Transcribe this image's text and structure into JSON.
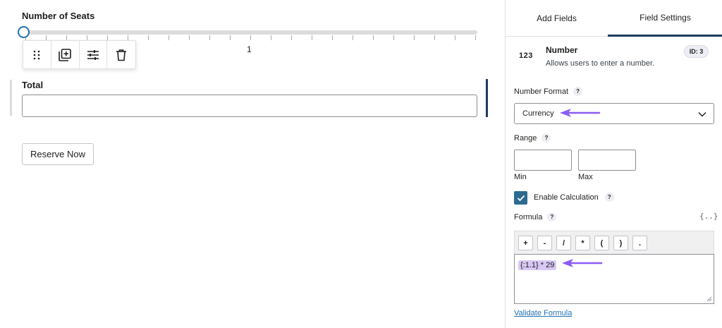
{
  "canvas": {
    "seats_label": "Number of Seats",
    "slider_value": "1",
    "slider_level": 0,
    "total_label": "Total",
    "total_value": "",
    "reserve_button": "Reserve Now"
  },
  "toolbar": {
    "icons": [
      "drag-handle-icon",
      "duplicate-icon",
      "settings-sliders-icon",
      "trash-icon"
    ]
  },
  "sidebar": {
    "tabs": [
      {
        "label": "Add Fields",
        "active": false
      },
      {
        "label": "Field Settings",
        "active": true
      }
    ],
    "field": {
      "icon_text": "123",
      "name": "Number",
      "description": "Allows users to enter a number.",
      "id_badge": "ID: 3"
    },
    "number_format": {
      "label": "Number Format",
      "help": "?",
      "selected": "Currency"
    },
    "range": {
      "label": "Range",
      "help": "?",
      "min_caption": "Min",
      "max_caption": "Max",
      "min_value": "",
      "max_value": ""
    },
    "calculation": {
      "label": "Enable Calculation",
      "help": "?",
      "checked": true
    },
    "formula": {
      "label": "Formula",
      "help": "?",
      "merge_tag_icon": "{..}",
      "operators": [
        "+",
        "-",
        "/",
        "*",
        "(",
        ")",
        "."
      ],
      "value": "{:1.1} * 29",
      "validate_link": "Validate Formula"
    }
  },
  "colors": {
    "accent": "#1d3a5c",
    "link": "#2271b1",
    "checkbox": "#2c6a8f",
    "annotation_arrow": "#8b5cf6",
    "formula_token": "#d8c8f5"
  }
}
